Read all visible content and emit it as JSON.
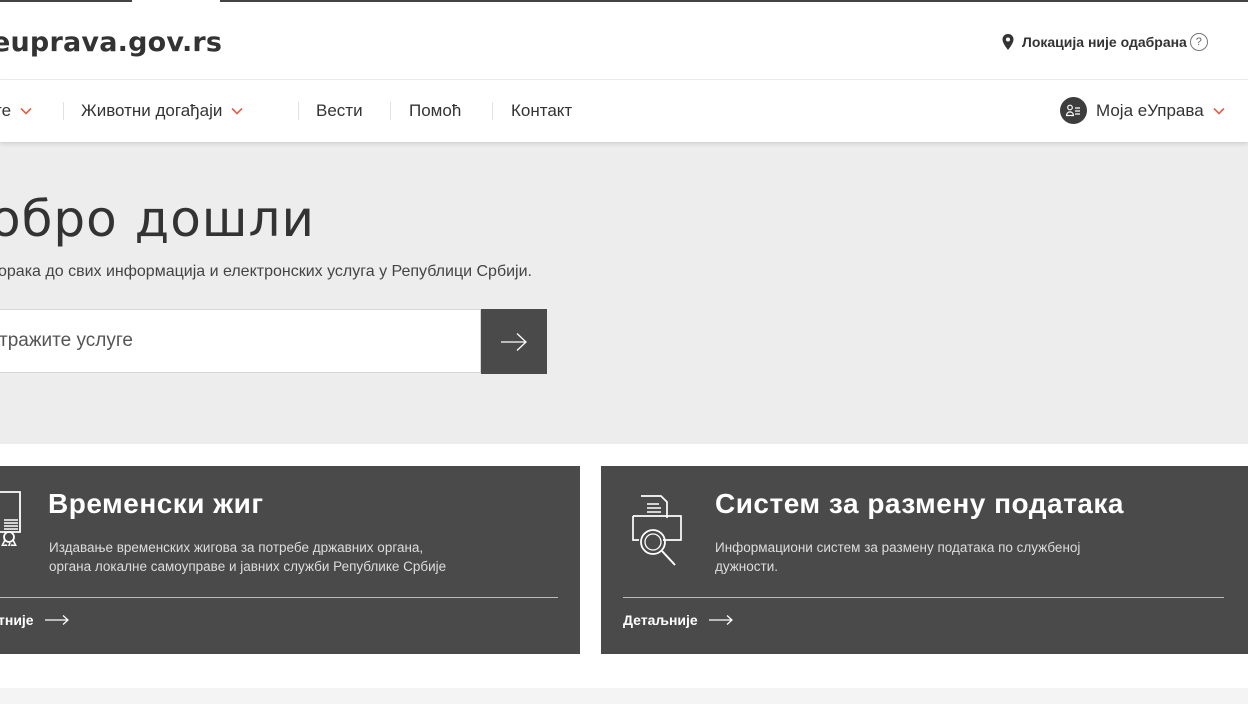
{
  "header": {
    "logo": "euprava.gov.rs",
    "location_label": "Локација није одабрана",
    "help_icon_text": "?"
  },
  "nav": {
    "items": [
      {
        "label": "те",
        "icon": "chevron-down-icon"
      },
      {
        "label": "Животни догађаји",
        "icon": "chevron-down-icon"
      },
      {
        "label": "Вести"
      },
      {
        "label": "Помоћ"
      },
      {
        "label": "Контакт"
      }
    ],
    "user_label": "Моја еУправа"
  },
  "hero": {
    "title": "обро дошли",
    "subtitle": "орака до свих информација и електронских услуга у Републици Србији.",
    "search_placeholder": "тражите услуге"
  },
  "cards": [
    {
      "title": "Временски жиг",
      "desc_line1": "Издавање временских жигова за потребе државних органа,",
      "desc_line2": "органа локалне самоуправе и јавних служби Републике Србије",
      "link": "тније",
      "icon": "certificate-icon"
    },
    {
      "title": "Систем за размену података",
      "desc_line1": "Информациони систем за размену података по службеној",
      "desc_line2": "дужности.",
      "link": "Детаљније",
      "icon": "document-search-icon"
    }
  ],
  "colors": {
    "dark": "#4a4a4a",
    "hero_bg": "#ededed",
    "text": "#333333"
  }
}
